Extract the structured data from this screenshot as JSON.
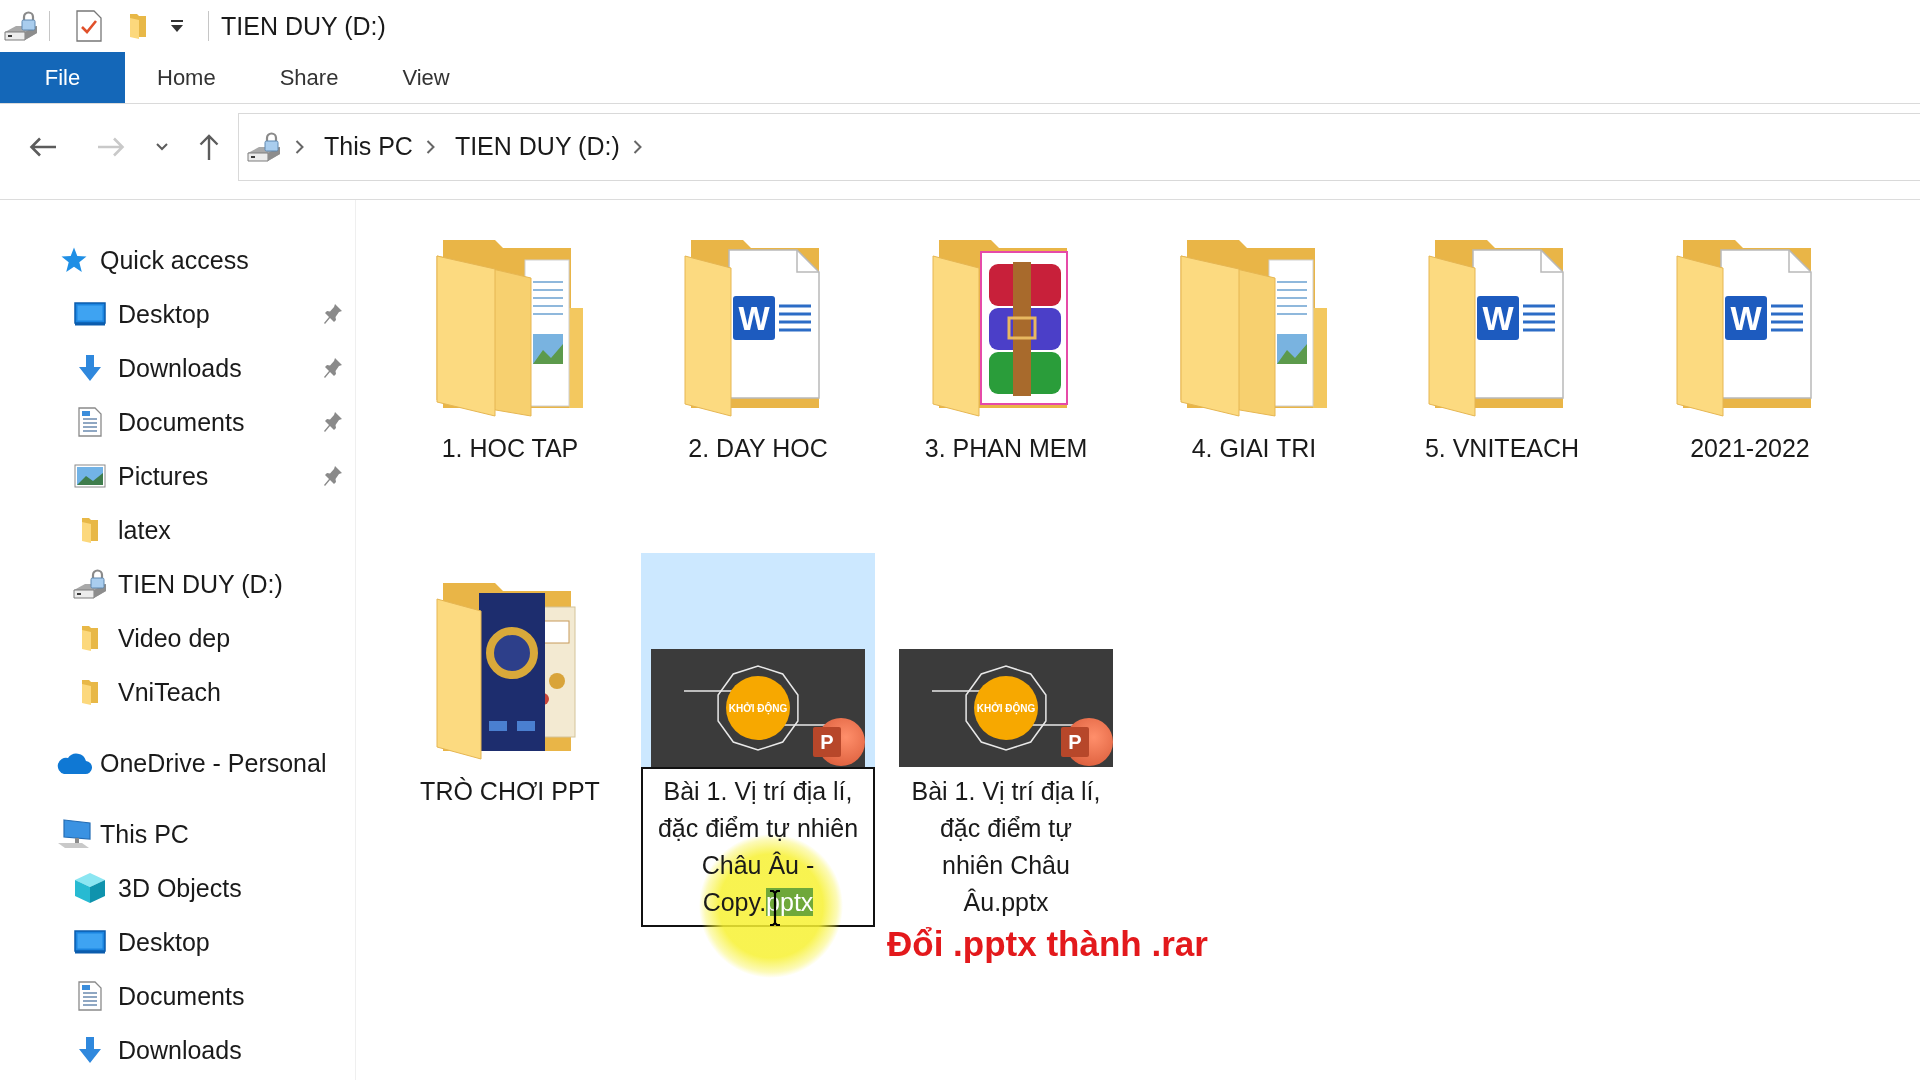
{
  "title_bar": {
    "title": "TIEN DUY (D:)"
  },
  "ribbon_tabs": [
    {
      "label": "File",
      "kind": "menu",
      "selected": false
    },
    {
      "label": "Home",
      "kind": "tab",
      "selected": false
    },
    {
      "label": "Share",
      "kind": "tab",
      "selected": false
    },
    {
      "label": "View",
      "kind": "tab",
      "selected": false
    }
  ],
  "navigation": [
    {
      "kind": "back",
      "disabled": false
    },
    {
      "kind": "forward",
      "disabled": true
    },
    {
      "kind": "recent",
      "disabled": false
    },
    {
      "kind": "up",
      "disabled": false
    }
  ],
  "address_bar": {
    "path": [
      "This PC",
      "TIEN DUY (D:)"
    ]
  },
  "sidebar": {
    "items": [
      {
        "label": "Quick access",
        "kind": "quick",
        "selected": false,
        "children": [
          {
            "label": "Desktop",
            "kind": "desktop",
            "pinned": true,
            "selected": false
          },
          {
            "label": "Downloads",
            "kind": "downloads",
            "pinned": true,
            "selected": false
          },
          {
            "label": "Documents",
            "kind": "documents",
            "pinned": true,
            "selected": false
          },
          {
            "label": "Pictures",
            "kind": "pictures",
            "pinned": true,
            "selected": false
          },
          {
            "label": "latex",
            "kind": "folder",
            "pinned": false,
            "selected": false
          },
          {
            "label": "TIEN DUY (D:)",
            "kind": "drive",
            "pinned": false,
            "selected": false
          },
          {
            "label": "Video dep",
            "kind": "folder",
            "pinned": false,
            "selected": false
          },
          {
            "label": "VniTeach",
            "kind": "folder",
            "pinned": false,
            "selected": false
          }
        ]
      },
      {
        "label": "OneDrive - Personal",
        "kind": "cloud",
        "selected": false
      },
      {
        "label": "This PC",
        "kind": "computer",
        "selected": false,
        "children": [
          {
            "label": "3D Objects",
            "kind": "objects3d",
            "selected": false
          },
          {
            "label": "Desktop",
            "kind": "desktop",
            "selected": false
          },
          {
            "label": "Documents",
            "kind": "documents",
            "selected": false
          },
          {
            "label": "Downloads",
            "kind": "downloads",
            "selected": false
          }
        ]
      }
    ]
  },
  "files": {
    "items": [
      {
        "name": "1. HOC TAP",
        "kind": "documents",
        "selected": false,
        "editing": false
      },
      {
        "name": "2. DAY HOC",
        "kind": "word",
        "badge": "W",
        "selected": false,
        "editing": false
      },
      {
        "name": "3. PHAN MEM",
        "kind": "archive",
        "selected": false,
        "editing": false
      },
      {
        "name": "4. GIAI TRI",
        "kind": "documents",
        "selected": false,
        "editing": false
      },
      {
        "name": "5. VNITEACH",
        "kind": "word",
        "badge": "W",
        "selected": false,
        "editing": false
      },
      {
        "name": "2021-2022",
        "kind": "word",
        "badge": "W",
        "selected": false,
        "editing": false
      },
      {
        "name": "TRÒ CHƠI PPT",
        "kind": "game",
        "selected": false,
        "editing": false
      },
      {
        "name": "Bài 1. Vị trí địa lí, đặc điểm tự nhiên Châu Âu - Copy.",
        "selected_text": "pptx",
        "kind": "presentation",
        "slide_title": "KHỞI ĐỘNG",
        "badge": "P",
        "selected": true,
        "editing": true
      },
      {
        "name": "Bài 1. Vị trí địa lí, đặc điểm tự nhiên Châu Âu.pptx",
        "kind": "presentation",
        "slide_title": "KHỞI ĐỘNG",
        "badge": "P",
        "selected": false,
        "editing": false
      }
    ]
  },
  "annotation": {
    "text": "Đổi .pptx thành .rar"
  }
}
